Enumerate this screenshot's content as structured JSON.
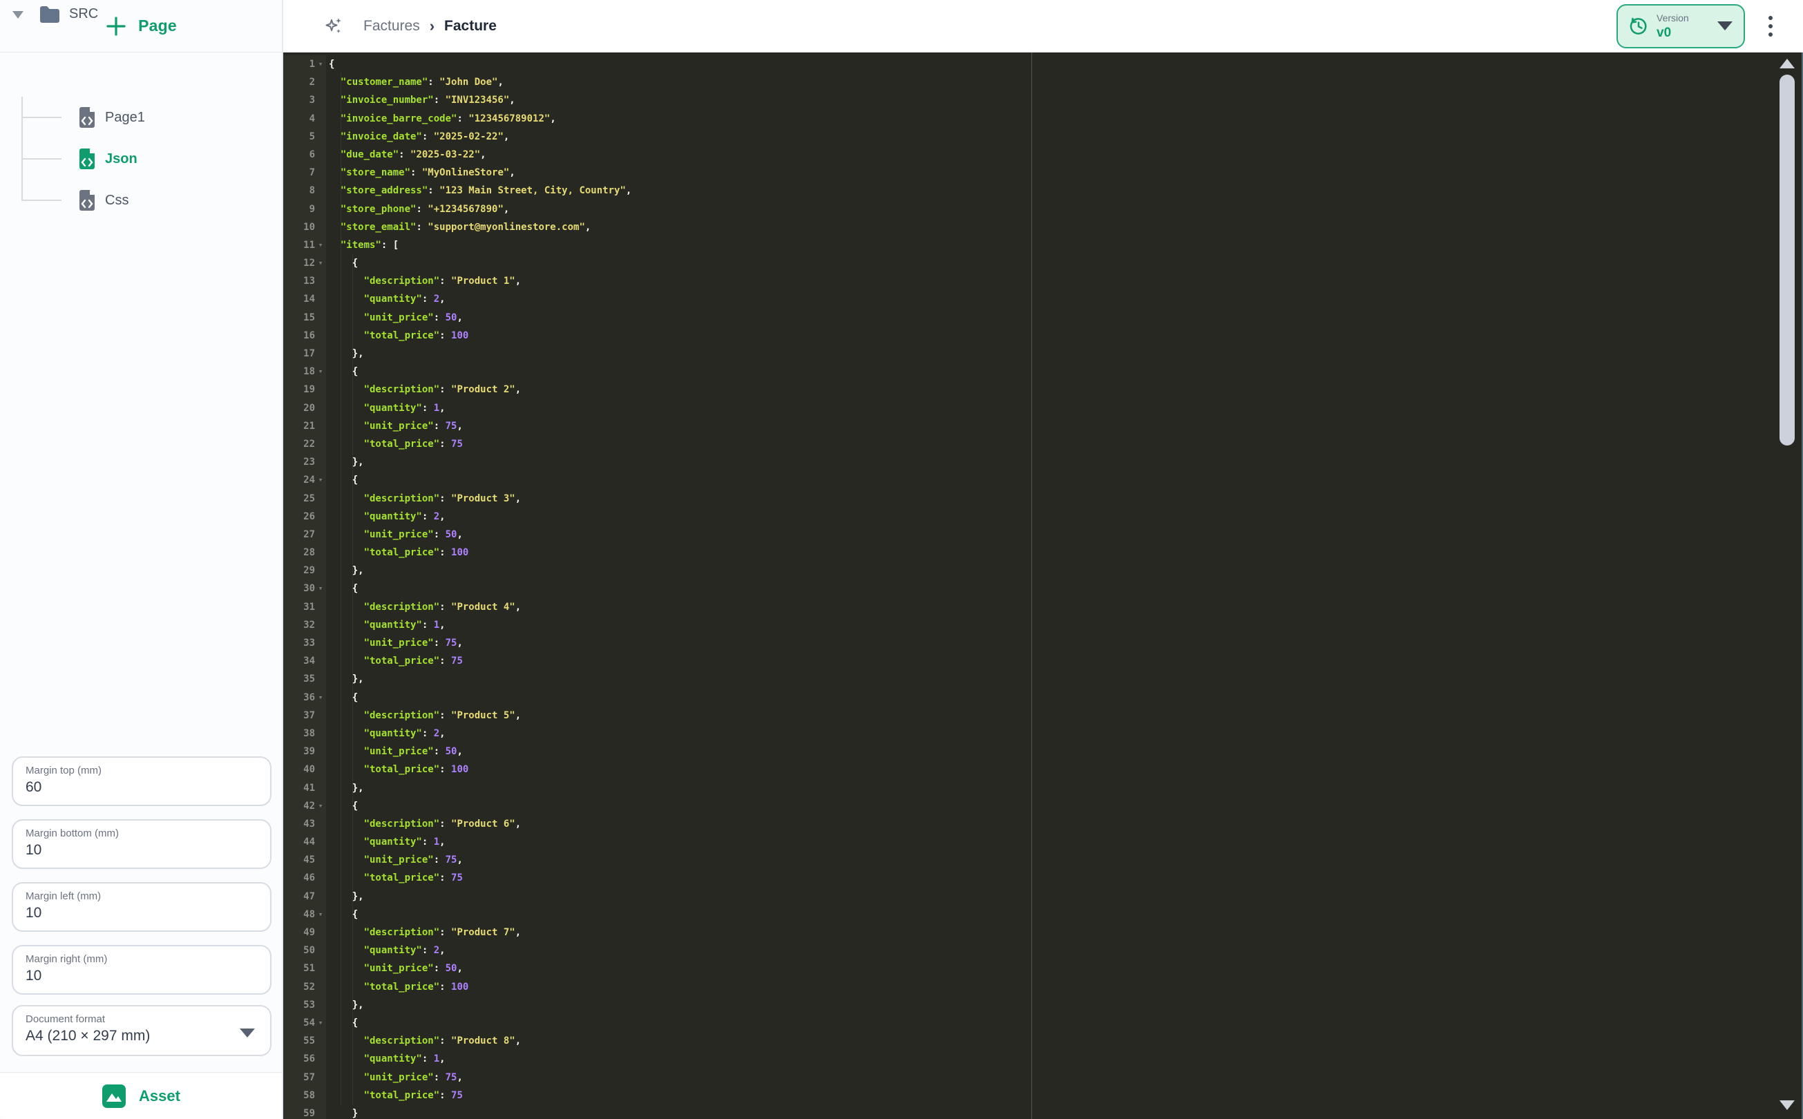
{
  "colors": {
    "accent": "#0f9d6d",
    "mint_bg": "#d9f3e6",
    "mint_border": "#2aa97c",
    "editor_bg": "#272822",
    "gutter_bg": "#2f3129",
    "gutter_text": "#8f908a",
    "code_key": "#a6e22e",
    "code_string": "#e6db74",
    "code_number": "#ae81ff",
    "code_punct": "#f8f8f2"
  },
  "sidebar": {
    "page_button": {
      "label": "Page",
      "icon": "plus-icon"
    },
    "tree": {
      "root": {
        "label": "SRC",
        "icon": "folder-icon",
        "expanded": true
      },
      "children": [
        {
          "label": "Page1",
          "icon": "file-code-icon",
          "state": "default"
        },
        {
          "label": "Json",
          "icon": "file-code-icon",
          "state": "active"
        },
        {
          "label": "Css",
          "icon": "file-code-icon",
          "state": "default"
        }
      ]
    },
    "margins": [
      {
        "label": "Margin top (mm)",
        "value": "60"
      },
      {
        "label": "Margin bottom (mm)",
        "value": "10"
      },
      {
        "label": "Margin left (mm)",
        "value": "10"
      },
      {
        "label": "Margin right (mm)",
        "value": "10"
      }
    ],
    "document_format": {
      "label": "Document format",
      "value": "A4 (210 × 297 mm)"
    },
    "asset_button": {
      "label": "Asset",
      "icon": "image-icon"
    }
  },
  "topbar": {
    "sparkles_icon": "sparkles-icon",
    "breadcrumb": {
      "parent": "Factures",
      "separator": "›",
      "current": "Facture"
    },
    "version": {
      "label": "Version",
      "value": "v0",
      "icon": "history-icon"
    },
    "menu_icon": "kebab-menu-icon"
  },
  "editor": {
    "lines": [
      {
        "n": 1,
        "fold": 1,
        "ind": 0,
        "t": [
          [
            "p",
            "{"
          ]
        ]
      },
      {
        "n": 2,
        "ind": 2,
        "t": [
          [
            "k",
            "\"customer_name\""
          ],
          [
            "p",
            ": "
          ],
          [
            "s",
            "\"John Doe\""
          ],
          [
            "p",
            ","
          ]
        ]
      },
      {
        "n": 3,
        "ind": 2,
        "t": [
          [
            "k",
            "\"invoice_number\""
          ],
          [
            "p",
            ": "
          ],
          [
            "s",
            "\"INV123456\""
          ],
          [
            "p",
            ","
          ]
        ]
      },
      {
        "n": 4,
        "ind": 2,
        "t": [
          [
            "k",
            "\"invoice_barre_code\""
          ],
          [
            "p",
            ": "
          ],
          [
            "s",
            "\"123456789012\""
          ],
          [
            "p",
            ","
          ]
        ]
      },
      {
        "n": 5,
        "ind": 2,
        "t": [
          [
            "k",
            "\"invoice_date\""
          ],
          [
            "p",
            ": "
          ],
          [
            "s",
            "\"2025-02-22\""
          ],
          [
            "p",
            ","
          ]
        ]
      },
      {
        "n": 6,
        "ind": 2,
        "t": [
          [
            "k",
            "\"due_date\""
          ],
          [
            "p",
            ": "
          ],
          [
            "s",
            "\"2025-03-22\""
          ],
          [
            "p",
            ","
          ]
        ]
      },
      {
        "n": 7,
        "ind": 2,
        "t": [
          [
            "k",
            "\"store_name\""
          ],
          [
            "p",
            ": "
          ],
          [
            "s",
            "\"MyOnlineStore\""
          ],
          [
            "p",
            ","
          ]
        ]
      },
      {
        "n": 8,
        "ind": 2,
        "t": [
          [
            "k",
            "\"store_address\""
          ],
          [
            "p",
            ": "
          ],
          [
            "s",
            "\"123 Main Street, City, Country\""
          ],
          [
            "p",
            ","
          ]
        ]
      },
      {
        "n": 9,
        "ind": 2,
        "t": [
          [
            "k",
            "\"store_phone\""
          ],
          [
            "p",
            ": "
          ],
          [
            "s",
            "\"+1234567890\""
          ],
          [
            "p",
            ","
          ]
        ]
      },
      {
        "n": 10,
        "ind": 2,
        "t": [
          [
            "k",
            "\"store_email\""
          ],
          [
            "p",
            ": "
          ],
          [
            "s",
            "\"support@myonlinestore.com\""
          ],
          [
            "p",
            ","
          ]
        ]
      },
      {
        "n": 11,
        "fold": 1,
        "ind": 2,
        "t": [
          [
            "k",
            "\"items\""
          ],
          [
            "p",
            ": ["
          ]
        ]
      },
      {
        "n": 12,
        "fold": 1,
        "ind": 4,
        "t": [
          [
            "p",
            "{"
          ]
        ]
      },
      {
        "n": 13,
        "ind": 6,
        "t": [
          [
            "k",
            "\"description\""
          ],
          [
            "p",
            ": "
          ],
          [
            "s",
            "\"Product 1\""
          ],
          [
            "p",
            ","
          ]
        ]
      },
      {
        "n": 14,
        "ind": 6,
        "t": [
          [
            "k",
            "\"quantity\""
          ],
          [
            "p",
            ": "
          ],
          [
            "n",
            "2"
          ],
          [
            "p",
            ","
          ]
        ]
      },
      {
        "n": 15,
        "ind": 6,
        "t": [
          [
            "k",
            "\"unit_price\""
          ],
          [
            "p",
            ": "
          ],
          [
            "n",
            "50"
          ],
          [
            "p",
            ","
          ]
        ]
      },
      {
        "n": 16,
        "ind": 6,
        "t": [
          [
            "k",
            "\"total_price\""
          ],
          [
            "p",
            ": "
          ],
          [
            "n",
            "100"
          ]
        ]
      },
      {
        "n": 17,
        "ind": 4,
        "t": [
          [
            "p",
            "},"
          ]
        ]
      },
      {
        "n": 18,
        "fold": 1,
        "ind": 4,
        "t": [
          [
            "p",
            "{"
          ]
        ]
      },
      {
        "n": 19,
        "ind": 6,
        "t": [
          [
            "k",
            "\"description\""
          ],
          [
            "p",
            ": "
          ],
          [
            "s",
            "\"Product 2\""
          ],
          [
            "p",
            ","
          ]
        ]
      },
      {
        "n": 20,
        "ind": 6,
        "t": [
          [
            "k",
            "\"quantity\""
          ],
          [
            "p",
            ": "
          ],
          [
            "n",
            "1"
          ],
          [
            "p",
            ","
          ]
        ]
      },
      {
        "n": 21,
        "ind": 6,
        "t": [
          [
            "k",
            "\"unit_price\""
          ],
          [
            "p",
            ": "
          ],
          [
            "n",
            "75"
          ],
          [
            "p",
            ","
          ]
        ]
      },
      {
        "n": 22,
        "ind": 6,
        "t": [
          [
            "k",
            "\"total_price\""
          ],
          [
            "p",
            ": "
          ],
          [
            "n",
            "75"
          ]
        ]
      },
      {
        "n": 23,
        "ind": 4,
        "t": [
          [
            "p",
            "},"
          ]
        ]
      },
      {
        "n": 24,
        "fold": 1,
        "ind": 4,
        "t": [
          [
            "p",
            "{"
          ]
        ]
      },
      {
        "n": 25,
        "ind": 6,
        "t": [
          [
            "k",
            "\"description\""
          ],
          [
            "p",
            ": "
          ],
          [
            "s",
            "\"Product 3\""
          ],
          [
            "p",
            ","
          ]
        ]
      },
      {
        "n": 26,
        "ind": 6,
        "t": [
          [
            "k",
            "\"quantity\""
          ],
          [
            "p",
            ": "
          ],
          [
            "n",
            "2"
          ],
          [
            "p",
            ","
          ]
        ]
      },
      {
        "n": 27,
        "ind": 6,
        "t": [
          [
            "k",
            "\"unit_price\""
          ],
          [
            "p",
            ": "
          ],
          [
            "n",
            "50"
          ],
          [
            "p",
            ","
          ]
        ]
      },
      {
        "n": 28,
        "ind": 6,
        "t": [
          [
            "k",
            "\"total_price\""
          ],
          [
            "p",
            ": "
          ],
          [
            "n",
            "100"
          ]
        ]
      },
      {
        "n": 29,
        "ind": 4,
        "t": [
          [
            "p",
            "},"
          ]
        ]
      },
      {
        "n": 30,
        "fold": 1,
        "ind": 4,
        "t": [
          [
            "p",
            "{"
          ]
        ]
      },
      {
        "n": 31,
        "ind": 6,
        "t": [
          [
            "k",
            "\"description\""
          ],
          [
            "p",
            ": "
          ],
          [
            "s",
            "\"Product 4\""
          ],
          [
            "p",
            ","
          ]
        ]
      },
      {
        "n": 32,
        "ind": 6,
        "t": [
          [
            "k",
            "\"quantity\""
          ],
          [
            "p",
            ": "
          ],
          [
            "n",
            "1"
          ],
          [
            "p",
            ","
          ]
        ]
      },
      {
        "n": 33,
        "ind": 6,
        "t": [
          [
            "k",
            "\"unit_price\""
          ],
          [
            "p",
            ": "
          ],
          [
            "n",
            "75"
          ],
          [
            "p",
            ","
          ]
        ]
      },
      {
        "n": 34,
        "ind": 6,
        "t": [
          [
            "k",
            "\"total_price\""
          ],
          [
            "p",
            ": "
          ],
          [
            "n",
            "75"
          ]
        ]
      },
      {
        "n": 35,
        "ind": 4,
        "t": [
          [
            "p",
            "},"
          ]
        ]
      },
      {
        "n": 36,
        "fold": 1,
        "ind": 4,
        "t": [
          [
            "p",
            "{"
          ]
        ]
      },
      {
        "n": 37,
        "ind": 6,
        "t": [
          [
            "k",
            "\"description\""
          ],
          [
            "p",
            ": "
          ],
          [
            "s",
            "\"Product 5\""
          ],
          [
            "p",
            ","
          ]
        ]
      },
      {
        "n": 38,
        "ind": 6,
        "t": [
          [
            "k",
            "\"quantity\""
          ],
          [
            "p",
            ": "
          ],
          [
            "n",
            "2"
          ],
          [
            "p",
            ","
          ]
        ]
      },
      {
        "n": 39,
        "ind": 6,
        "t": [
          [
            "k",
            "\"unit_price\""
          ],
          [
            "p",
            ": "
          ],
          [
            "n",
            "50"
          ],
          [
            "p",
            ","
          ]
        ]
      },
      {
        "n": 40,
        "ind": 6,
        "t": [
          [
            "k",
            "\"total_price\""
          ],
          [
            "p",
            ": "
          ],
          [
            "n",
            "100"
          ]
        ]
      },
      {
        "n": 41,
        "ind": 4,
        "t": [
          [
            "p",
            "},"
          ]
        ]
      },
      {
        "n": 42,
        "fold": 1,
        "ind": 4,
        "t": [
          [
            "p",
            "{"
          ]
        ]
      },
      {
        "n": 43,
        "ind": 6,
        "t": [
          [
            "k",
            "\"description\""
          ],
          [
            "p",
            ": "
          ],
          [
            "s",
            "\"Product 6\""
          ],
          [
            "p",
            ","
          ]
        ]
      },
      {
        "n": 44,
        "ind": 6,
        "t": [
          [
            "k",
            "\"quantity\""
          ],
          [
            "p",
            ": "
          ],
          [
            "n",
            "1"
          ],
          [
            "p",
            ","
          ]
        ]
      },
      {
        "n": 45,
        "ind": 6,
        "t": [
          [
            "k",
            "\"unit_price\""
          ],
          [
            "p",
            ": "
          ],
          [
            "n",
            "75"
          ],
          [
            "p",
            ","
          ]
        ]
      },
      {
        "n": 46,
        "ind": 6,
        "t": [
          [
            "k",
            "\"total_price\""
          ],
          [
            "p",
            ": "
          ],
          [
            "n",
            "75"
          ]
        ]
      },
      {
        "n": 47,
        "ind": 4,
        "t": [
          [
            "p",
            "},"
          ]
        ]
      },
      {
        "n": 48,
        "fold": 1,
        "ind": 4,
        "t": [
          [
            "p",
            "{"
          ]
        ]
      },
      {
        "n": 49,
        "ind": 6,
        "t": [
          [
            "k",
            "\"description\""
          ],
          [
            "p",
            ": "
          ],
          [
            "s",
            "\"Product 7\""
          ],
          [
            "p",
            ","
          ]
        ]
      },
      {
        "n": 50,
        "ind": 6,
        "t": [
          [
            "k",
            "\"quantity\""
          ],
          [
            "p",
            ": "
          ],
          [
            "n",
            "2"
          ],
          [
            "p",
            ","
          ]
        ]
      },
      {
        "n": 51,
        "ind": 6,
        "t": [
          [
            "k",
            "\"unit_price\""
          ],
          [
            "p",
            ": "
          ],
          [
            "n",
            "50"
          ],
          [
            "p",
            ","
          ]
        ]
      },
      {
        "n": 52,
        "ind": 6,
        "t": [
          [
            "k",
            "\"total_price\""
          ],
          [
            "p",
            ": "
          ],
          [
            "n",
            "100"
          ]
        ]
      },
      {
        "n": 53,
        "ind": 4,
        "t": [
          [
            "p",
            "},"
          ]
        ]
      },
      {
        "n": 54,
        "fold": 1,
        "ind": 4,
        "t": [
          [
            "p",
            "{"
          ]
        ]
      },
      {
        "n": 55,
        "ind": 6,
        "t": [
          [
            "k",
            "\"description\""
          ],
          [
            "p",
            ": "
          ],
          [
            "s",
            "\"Product 8\""
          ],
          [
            "p",
            ","
          ]
        ]
      },
      {
        "n": 56,
        "ind": 6,
        "t": [
          [
            "k",
            "\"quantity\""
          ],
          [
            "p",
            ": "
          ],
          [
            "n",
            "1"
          ],
          [
            "p",
            ","
          ]
        ]
      },
      {
        "n": 57,
        "ind": 6,
        "t": [
          [
            "k",
            "\"unit_price\""
          ],
          [
            "p",
            ": "
          ],
          [
            "n",
            "75"
          ],
          [
            "p",
            ","
          ]
        ]
      },
      {
        "n": 58,
        "ind": 6,
        "t": [
          [
            "k",
            "\"total_price\""
          ],
          [
            "p",
            ": "
          ],
          [
            "n",
            "75"
          ]
        ]
      },
      {
        "n": 59,
        "ind": 4,
        "t": [
          [
            "p",
            "}"
          ]
        ]
      }
    ]
  }
}
